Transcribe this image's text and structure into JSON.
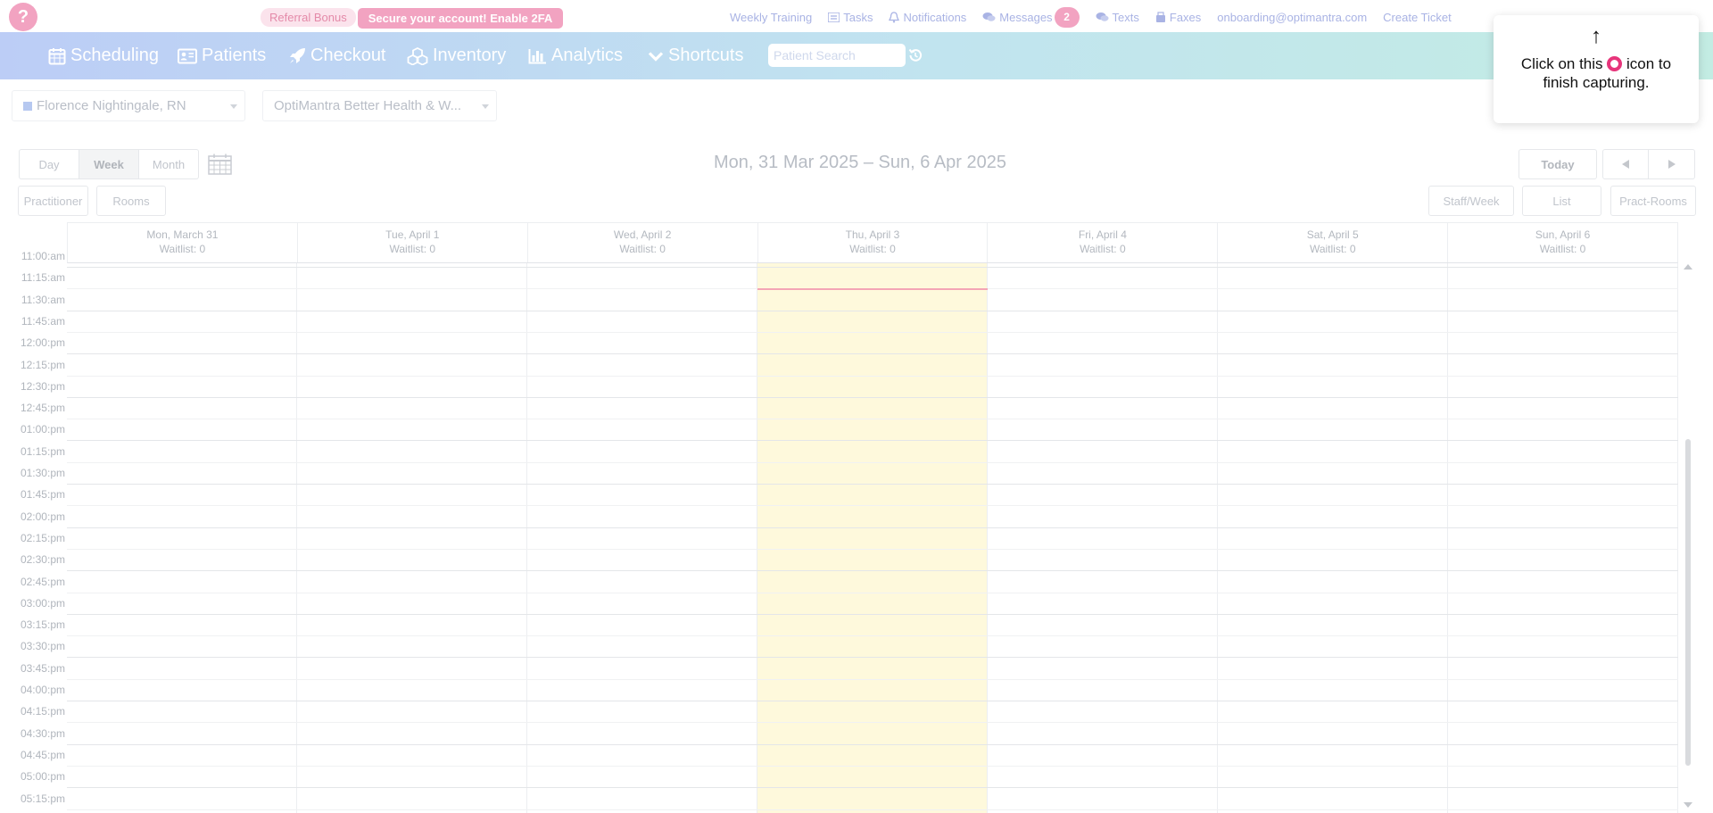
{
  "topbar": {
    "help_label": "?",
    "referral_label": "Referral Bonus",
    "secure_label": "Secure your account! Enable 2FA",
    "links": {
      "weekly_training": "Weekly Training",
      "tasks": "Tasks",
      "notifications": "Notifications",
      "messages": "Messages",
      "messages_count": "2",
      "texts": "Texts",
      "faxes": "Faxes",
      "email": "onboarding@optimantra.com",
      "create_ticket": "Create Ticket"
    }
  },
  "nav": {
    "items": [
      {
        "label": "Scheduling",
        "icon": "calendar-icon"
      },
      {
        "label": "Patients",
        "icon": "id-card-icon"
      },
      {
        "label": "Checkout",
        "icon": "rocket-icon"
      },
      {
        "label": "Inventory",
        "icon": "cubes-icon"
      },
      {
        "label": "Analytics",
        "icon": "bar-chart-icon"
      },
      {
        "label": "Shortcuts",
        "icon": "check-icon"
      }
    ],
    "search_placeholder": "Patient Search"
  },
  "filters": {
    "practitioner": "Florence Nightingale, RN",
    "location": "OptiMantra Better Health & W..."
  },
  "view": {
    "day": "Day",
    "week": "Week",
    "month": "Month",
    "practitioner": "Practitioner",
    "rooms": "Rooms",
    "today": "Today",
    "staff_week": "Staff/Week",
    "list": "List",
    "pract_rooms": "Pract-Rooms",
    "date_range": "Mon, 31 Mar 2025 – Sun, 6 Apr 2025"
  },
  "tooltip": {
    "arrow": "↑",
    "text_before": "Click on this",
    "text_after": "icon to finish capturing."
  },
  "calendar": {
    "days": [
      {
        "name": "Mon, March 31",
        "waitlist": "Waitlist: 0"
      },
      {
        "name": "Tue, April 1",
        "waitlist": "Waitlist: 0"
      },
      {
        "name": "Wed, April 2",
        "waitlist": "Waitlist: 0"
      },
      {
        "name": "Thu, April 3",
        "waitlist": "Waitlist: 0"
      },
      {
        "name": "Fri, April 4",
        "waitlist": "Waitlist: 0"
      },
      {
        "name": "Sat, April 5",
        "waitlist": "Waitlist: 0"
      },
      {
        "name": "Sun, April 6",
        "waitlist": "Waitlist: 0"
      }
    ],
    "today_index": 3,
    "times": [
      "11:00:am",
      "11:15:am",
      "11:30:am",
      "11:45:am",
      "12:00:pm",
      "12:15:pm",
      "12:30:pm",
      "12:45:pm",
      "01:00:pm",
      "01:15:pm",
      "01:30:pm",
      "01:45:pm",
      "02:00:pm",
      "02:15:pm",
      "02:30:pm",
      "02:45:pm",
      "03:00:pm",
      "03:15:pm",
      "03:30:pm",
      "03:45:pm",
      "04:00:pm",
      "04:15:pm",
      "04:30:pm",
      "04:45:pm",
      "05:00:pm",
      "05:15:pm"
    ]
  },
  "colors": {
    "accent_pink": "#f2a3c1",
    "nav_gradient_start": "#bccdf6",
    "nav_gradient_end": "#c3ece3",
    "today_bg": "#fef9dc",
    "now_line": "#f4a5b5",
    "record_icon": "#e7357b"
  }
}
